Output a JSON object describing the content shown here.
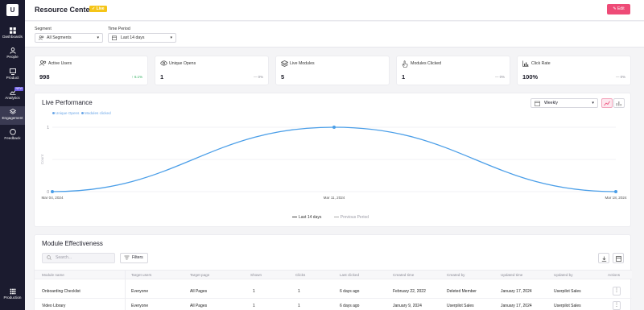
{
  "sidebar": {
    "logo": "U",
    "items": [
      {
        "label": "Dashboards",
        "icon": "grid-icon"
      },
      {
        "label": "People",
        "icon": "people-icon"
      },
      {
        "label": "Product",
        "icon": "product-icon"
      },
      {
        "label": "Analytics",
        "icon": "chart-icon",
        "badge": "NEW"
      },
      {
        "label": "Engagement",
        "icon": "layers-icon"
      },
      {
        "label": "Feedback",
        "icon": "chat-icon"
      },
      {
        "label": "Production",
        "icon": "apps-icon"
      }
    ]
  },
  "header": {
    "title": "Resource Center",
    "status_badge": "✓ Live",
    "edit_label": "✎ Edit"
  },
  "filters": {
    "segment_label": "Segment",
    "segment_value": "All Segments",
    "period_label": "Time Period",
    "period_value": "Last 14 days"
  },
  "metrics": [
    {
      "label": "Active Users",
      "value": "998",
      "change": "↑ 6.1%",
      "icon": "users-icon"
    },
    {
      "label": "Unique Opens",
      "value": "1",
      "change": "— 0%",
      "icon": "eye-icon"
    },
    {
      "label": "Live Modules",
      "value": "5",
      "change": "",
      "icon": "stack-icon"
    },
    {
      "label": "Modules Clicked",
      "value": "1",
      "change": "— 0%",
      "icon": "hand-icon"
    },
    {
      "label": "Click Rate",
      "value": "100%",
      "change": "— 0%",
      "icon": "bar-icon"
    }
  ],
  "performance": {
    "title": "Live Performance",
    "granularity": "Weekly",
    "legend_top": [
      "Unique Opens",
      "Modules clicked"
    ],
    "legend_bottom_current": "Last 14 days",
    "legend_bottom_previous": "Previous Period"
  },
  "chart_data": {
    "type": "line",
    "title": "",
    "xlabel": "",
    "ylabel": "Count",
    "x": [
      "Mar 04, 2024",
      "Mar 11, 2024",
      "Mar 18, 2024"
    ],
    "yticks": [
      "0",
      "1"
    ],
    "ylim": [
      0,
      1
    ],
    "series": [
      {
        "name": "Last 14 days",
        "values": [
          0,
          1,
          0
        ],
        "color": "#4a9ee8"
      }
    ],
    "grid": true,
    "legend": "bottom"
  },
  "modules": {
    "title": "Module Effectiveness",
    "search_placeholder": "Search...",
    "filters_label": "Filters",
    "columns": [
      "Module name",
      "Target users",
      "Target page",
      "Shown",
      "Clicks",
      "Last clicked",
      "Created time",
      "Created by",
      "Updated time",
      "Updated by",
      "Actions"
    ],
    "rows": [
      [
        "Onboarding Checklist",
        "Everyone",
        "All Pages",
        "1",
        "1",
        "6 days ago",
        "February 22, 2022",
        "Deleted Member",
        "January 17, 2024",
        "Userpilot Sales",
        "⋮"
      ],
      [
        "Video Library",
        "Everyone",
        "All Pages",
        "1",
        "1",
        "6 days ago",
        "January 9, 2024",
        "Userpilot Sales",
        "January 17, 2024",
        "Userpilot Sales",
        "⋮"
      ]
    ]
  },
  "colors": {
    "sidebar": "#1b1b2f",
    "accent": "#ee4b77",
    "live": "#f5c518",
    "line": "#4a9ee8",
    "positive": "#2eae5e"
  }
}
